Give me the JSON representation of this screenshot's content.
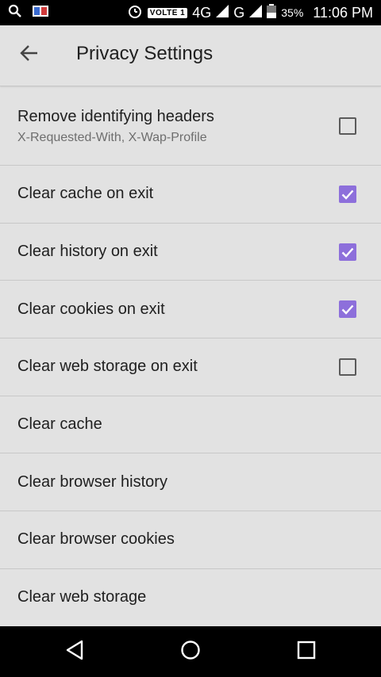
{
  "status_bar": {
    "volte": "VOLTE 1",
    "net_4g": "4G",
    "net_g": "G",
    "battery": "35%",
    "time": "11:06 PM"
  },
  "header": {
    "title": "Privacy Settings"
  },
  "settings": [
    {
      "label": "Remove identifying headers",
      "sub": "X-Requested-With, X-Wap-Profile",
      "checked": false,
      "has_checkbox": true
    },
    {
      "label": "Clear cache on exit",
      "checked": true,
      "has_checkbox": true
    },
    {
      "label": "Clear history on exit",
      "checked": true,
      "has_checkbox": true
    },
    {
      "label": "Clear cookies on exit",
      "checked": true,
      "has_checkbox": true
    },
    {
      "label": "Clear web storage on exit",
      "checked": false,
      "has_checkbox": true
    },
    {
      "label": "Clear cache",
      "has_checkbox": false
    },
    {
      "label": "Clear browser history",
      "has_checkbox": false
    },
    {
      "label": "Clear browser cookies",
      "has_checkbox": false
    },
    {
      "label": "Clear web storage",
      "has_checkbox": false
    }
  ],
  "colors": {
    "accent": "#8d6fdb",
    "background": "#e2e2e2"
  }
}
